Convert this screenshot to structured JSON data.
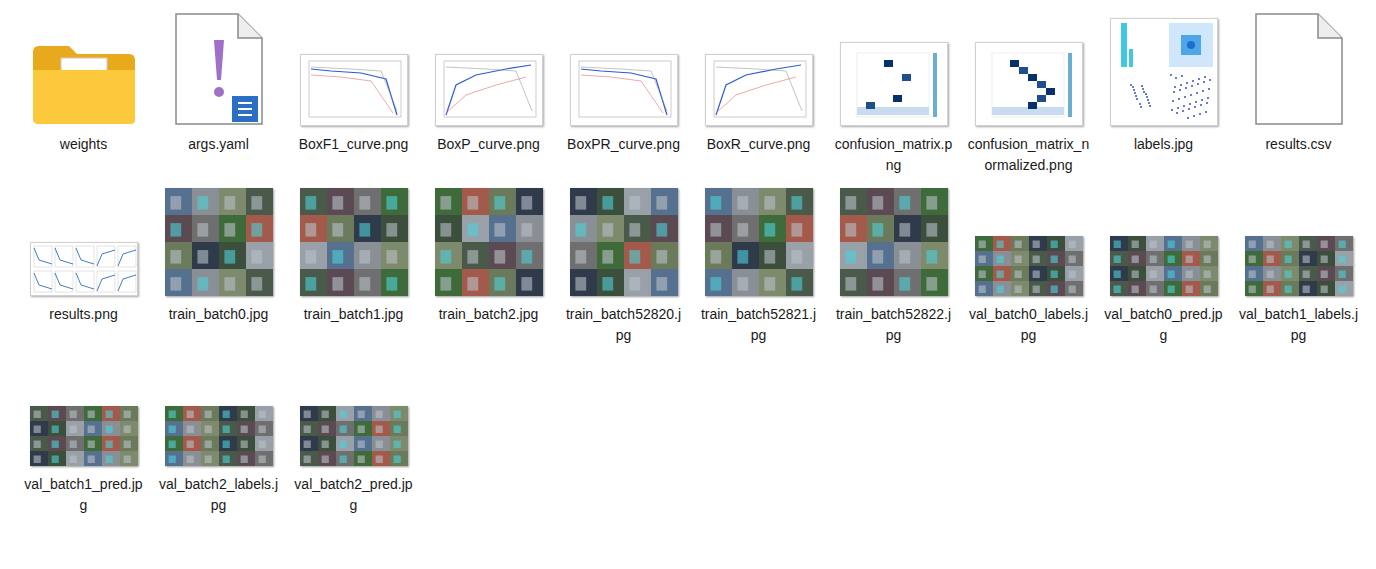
{
  "window": {
    "view": "file-explorer-large-icons"
  },
  "items": [
    {
      "name": "weights",
      "kind": "folder"
    },
    {
      "name": "args.yaml",
      "kind": "yaml"
    },
    {
      "name": "BoxF1_curve.png",
      "kind": "chart"
    },
    {
      "name": "BoxP_curve.png",
      "kind": "chart"
    },
    {
      "name": "BoxPR_curve.png",
      "kind": "chart"
    },
    {
      "name": "BoxR_curve.png",
      "kind": "chart"
    },
    {
      "name": "confusion_matrix.png",
      "kind": "matrix"
    },
    {
      "name": "confusion_matrix_normalized.png",
      "kind": "matrix"
    },
    {
      "name": "labels.jpg",
      "kind": "labels"
    },
    {
      "name": "results.csv",
      "kind": "blank"
    },
    {
      "name": "results.png",
      "kind": "results"
    },
    {
      "name": "train_batch0.jpg",
      "kind": "square-photo"
    },
    {
      "name": "train_batch1.jpg",
      "kind": "square-photo"
    },
    {
      "name": "train_batch2.jpg",
      "kind": "square-photo"
    },
    {
      "name": "train_batch52820.jpg",
      "kind": "square-photo"
    },
    {
      "name": "train_batch52821.jpg",
      "kind": "square-photo"
    },
    {
      "name": "train_batch52822.jpg",
      "kind": "square-photo"
    },
    {
      "name": "val_batch0_labels.jpg",
      "kind": "wide-photo"
    },
    {
      "name": "val_batch0_pred.jpg",
      "kind": "wide-photo"
    },
    {
      "name": "val_batch1_labels.jpg",
      "kind": "wide-photo"
    },
    {
      "name": "val_batch1_pred.jpg",
      "kind": "wide-photo"
    },
    {
      "name": "val_batch2_labels.jpg",
      "kind": "wide-photo"
    },
    {
      "name": "val_batch2_pred.jpg",
      "kind": "wide-photo"
    }
  ]
}
